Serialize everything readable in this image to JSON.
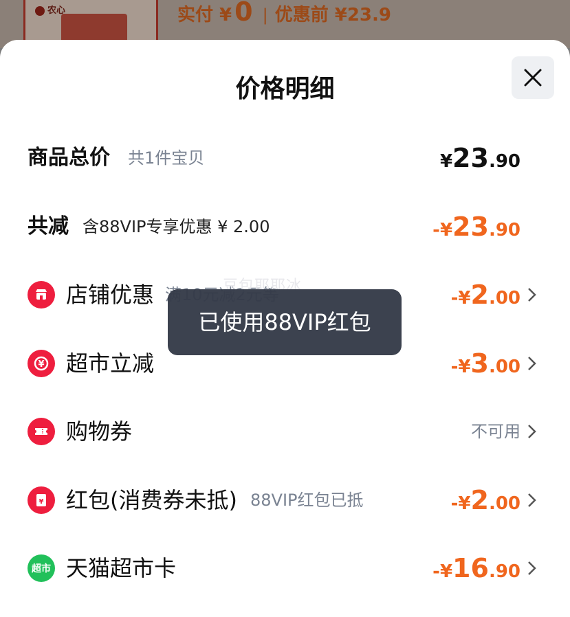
{
  "background": {
    "logo_text": "农心",
    "price_prefix": "实付 ¥",
    "price_value": "0",
    "separator": "|",
    "original_price": "优惠前 ¥23.9"
  },
  "sheet": {
    "title": "价格明细",
    "close_icon": "close-icon"
  },
  "total": {
    "label": "商品总价",
    "sub": "共1件宝贝",
    "currency": "¥",
    "int": "23",
    "dec": ".90"
  },
  "reduction": {
    "label": "共减",
    "sub": "含88VIP专享优惠 ¥ 2.00",
    "currency": "-¥",
    "int": "23",
    "dec": ".90"
  },
  "items": [
    {
      "icon": "store-icon",
      "label": "店铺优惠",
      "sub": "满10元减2元等",
      "currency": "-¥",
      "int": "2",
      "dec": ".00"
    },
    {
      "icon": "yen-refresh-icon",
      "label": "超市立减",
      "sub": "",
      "currency": "-¥",
      "int": "3",
      "dec": ".00"
    },
    {
      "icon": "ticket-icon",
      "label": "购物券",
      "status": "不可用"
    },
    {
      "icon": "red-envelope-icon",
      "label": "红包(消费券未抵)",
      "sub": "88VIP红包已抵",
      "currency": "-¥",
      "int": "2",
      "dec": ".00"
    },
    {
      "icon": "tmall-supermarket-icon",
      "icon_text": "超市",
      "label": "天猫超市卡",
      "currency": "-¥",
      "int": "16",
      "dec": ".90"
    }
  ],
  "toast": "已使用88VIP红包",
  "watermark": "豆包耶耶冰",
  "colors": {
    "accent_orange": "#f0661e",
    "icon_red": "#ee1e3e",
    "icon_green": "#21c05a",
    "toast_bg": "#343a48"
  }
}
